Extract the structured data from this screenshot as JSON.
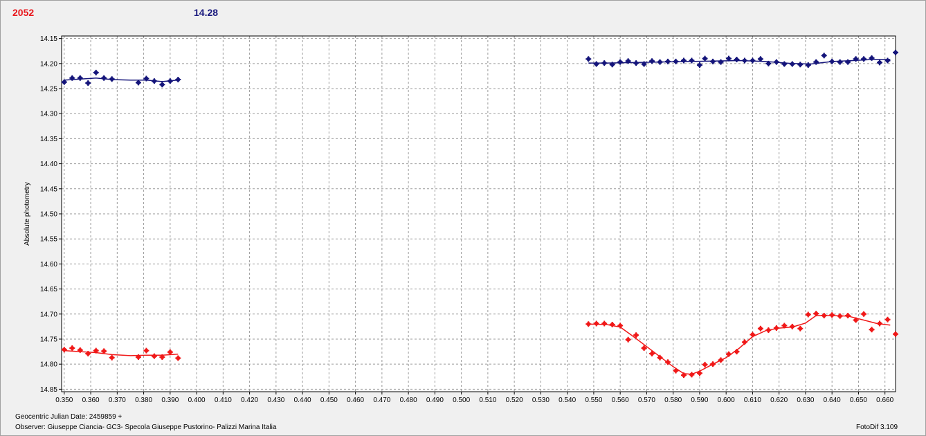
{
  "header": {
    "left_value": "2052",
    "right_value": "14.28"
  },
  "footer": {
    "julian_date": "Geocentric Julian Date: 2459859 +",
    "observer": "Observer: Giuseppe Ciancia- GC3- Specola Giuseppe Pustorino- Palizzi Marina Italia",
    "software": "FotoDif 3.109"
  },
  "colors": {
    "red_series": "#f01818",
    "blue_series": "#14147a",
    "grid": "#9a9a9a",
    "plot_bg": "#ffffff"
  },
  "chart_data": {
    "type": "scatter",
    "title": "",
    "xlabel": "",
    "ylabel": "Absolute photometry",
    "xlim": [
      0.349,
      0.664
    ],
    "ylim": [
      14.855,
      14.145
    ],
    "y_inverted": true,
    "grid": true,
    "x_ticks": [
      "0.350",
      "0.360",
      "0.370",
      "0.380",
      "0.390",
      "0.400",
      "0.410",
      "0.420",
      "0.430",
      "0.440",
      "0.450",
      "0.460",
      "0.470",
      "0.480",
      "0.490",
      "0.500",
      "0.510",
      "0.520",
      "0.530",
      "0.540",
      "0.550",
      "0.560",
      "0.570",
      "0.580",
      "0.590",
      "0.600",
      "0.610",
      "0.620",
      "0.630",
      "0.640",
      "0.650",
      "0.660"
    ],
    "y_ticks": [
      "14.15",
      "14.20",
      "14.25",
      "14.30",
      "14.35",
      "14.40",
      "14.45",
      "14.50",
      "14.55",
      "14.60",
      "14.65",
      "14.70",
      "14.75",
      "14.80",
      "14.85"
    ],
    "series": [
      {
        "color": "#14147a",
        "points": [
          [
            0.35,
            14.237
          ],
          [
            0.353,
            14.229
          ],
          [
            0.356,
            14.229
          ],
          [
            0.359,
            14.239
          ],
          [
            0.362,
            14.218
          ],
          [
            0.365,
            14.229
          ],
          [
            0.368,
            14.231
          ],
          [
            0.378,
            14.238
          ],
          [
            0.381,
            14.23
          ],
          [
            0.384,
            14.235
          ],
          [
            0.387,
            14.242
          ],
          [
            0.39,
            14.235
          ],
          [
            0.393,
            14.232
          ],
          [
            0.548,
            14.191
          ],
          [
            0.551,
            14.201
          ],
          [
            0.554,
            14.199
          ],
          [
            0.557,
            14.202
          ],
          [
            0.56,
            14.197
          ],
          [
            0.563,
            14.195
          ],
          [
            0.566,
            14.199
          ],
          [
            0.569,
            14.201
          ],
          [
            0.572,
            14.195
          ],
          [
            0.575,
            14.197
          ],
          [
            0.578,
            14.196
          ],
          [
            0.581,
            14.196
          ],
          [
            0.584,
            14.194
          ],
          [
            0.587,
            14.194
          ],
          [
            0.59,
            14.203
          ],
          [
            0.592,
            14.19
          ],
          [
            0.595,
            14.196
          ],
          [
            0.598,
            14.197
          ],
          [
            0.601,
            14.19
          ],
          [
            0.604,
            14.192
          ],
          [
            0.607,
            14.194
          ],
          [
            0.61,
            14.194
          ],
          [
            0.613,
            14.191
          ],
          [
            0.616,
            14.2
          ],
          [
            0.619,
            14.197
          ],
          [
            0.622,
            14.201
          ],
          [
            0.625,
            14.201
          ],
          [
            0.628,
            14.202
          ],
          [
            0.631,
            14.203
          ],
          [
            0.634,
            14.197
          ],
          [
            0.637,
            14.184
          ],
          [
            0.64,
            14.196
          ],
          [
            0.643,
            14.197
          ],
          [
            0.646,
            14.197
          ],
          [
            0.649,
            14.191
          ],
          [
            0.652,
            14.191
          ],
          [
            0.655,
            14.189
          ],
          [
            0.658,
            14.198
          ],
          [
            0.661,
            14.194
          ],
          [
            0.664,
            14.178
          ]
        ],
        "fit": [
          [
            0.35,
            14.233
          ],
          [
            0.356,
            14.231
          ],
          [
            0.362,
            14.229
          ],
          [
            0.368,
            14.232
          ],
          [
            0.375,
            14.233
          ],
          [
            0.381,
            14.233
          ],
          [
            0.387,
            14.236
          ],
          [
            0.393,
            14.233
          ],
          [
            0.548,
            14.199
          ],
          [
            0.555,
            14.199
          ],
          [
            0.565,
            14.198
          ],
          [
            0.575,
            14.197
          ],
          [
            0.585,
            14.196
          ],
          [
            0.595,
            14.195
          ],
          [
            0.605,
            14.194
          ],
          [
            0.615,
            14.196
          ],
          [
            0.625,
            14.2
          ],
          [
            0.632,
            14.201
          ],
          [
            0.64,
            14.196
          ],
          [
            0.648,
            14.194
          ],
          [
            0.655,
            14.192
          ],
          [
            0.662,
            14.192
          ]
        ]
      },
      {
        "color": "#f01818",
        "points": [
          [
            0.35,
            14.771
          ],
          [
            0.353,
            14.768
          ],
          [
            0.356,
            14.772
          ],
          [
            0.359,
            14.779
          ],
          [
            0.362,
            14.773
          ],
          [
            0.365,
            14.774
          ],
          [
            0.368,
            14.787
          ],
          [
            0.378,
            14.786
          ],
          [
            0.381,
            14.773
          ],
          [
            0.384,
            14.784
          ],
          [
            0.387,
            14.786
          ],
          [
            0.39,
            14.776
          ],
          [
            0.393,
            14.788
          ],
          [
            0.548,
            14.72
          ],
          [
            0.551,
            14.719
          ],
          [
            0.554,
            14.719
          ],
          [
            0.557,
            14.721
          ],
          [
            0.56,
            14.723
          ],
          [
            0.563,
            14.751
          ],
          [
            0.566,
            14.742
          ],
          [
            0.569,
            14.768
          ],
          [
            0.572,
            14.779
          ],
          [
            0.575,
            14.787
          ],
          [
            0.578,
            14.796
          ],
          [
            0.581,
            14.813
          ],
          [
            0.584,
            14.822
          ],
          [
            0.587,
            14.821
          ],
          [
            0.59,
            14.818
          ],
          [
            0.592,
            14.801
          ],
          [
            0.595,
            14.8
          ],
          [
            0.598,
            14.792
          ],
          [
            0.601,
            14.78
          ],
          [
            0.604,
            14.775
          ],
          [
            0.607,
            14.756
          ],
          [
            0.61,
            14.741
          ],
          [
            0.613,
            14.729
          ],
          [
            0.616,
            14.732
          ],
          [
            0.619,
            14.728
          ],
          [
            0.622,
            14.723
          ],
          [
            0.625,
            14.725
          ],
          [
            0.628,
            14.729
          ],
          [
            0.631,
            14.701
          ],
          [
            0.634,
            14.699
          ],
          [
            0.637,
            14.703
          ],
          [
            0.64,
            14.702
          ],
          [
            0.643,
            14.704
          ],
          [
            0.646,
            14.703
          ],
          [
            0.649,
            14.712
          ],
          [
            0.652,
            14.7
          ],
          [
            0.655,
            14.731
          ],
          [
            0.658,
            14.719
          ],
          [
            0.661,
            14.711
          ],
          [
            0.664,
            14.74
          ]
        ],
        "fit": [
          [
            0.35,
            14.773
          ],
          [
            0.356,
            14.775
          ],
          [
            0.362,
            14.777
          ],
          [
            0.368,
            14.781
          ],
          [
            0.375,
            14.783
          ],
          [
            0.381,
            14.782
          ],
          [
            0.387,
            14.782
          ],
          [
            0.393,
            14.78
          ],
          [
            0.548,
            14.72
          ],
          [
            0.555,
            14.721
          ],
          [
            0.56,
            14.726
          ],
          [
            0.565,
            14.745
          ],
          [
            0.57,
            14.765
          ],
          [
            0.575,
            14.785
          ],
          [
            0.58,
            14.805
          ],
          [
            0.584,
            14.819
          ],
          [
            0.587,
            14.82
          ],
          [
            0.59,
            14.814
          ],
          [
            0.595,
            14.8
          ],
          [
            0.6,
            14.787
          ],
          [
            0.605,
            14.768
          ],
          [
            0.61,
            14.745
          ],
          [
            0.615,
            14.733
          ],
          [
            0.62,
            14.728
          ],
          [
            0.625,
            14.726
          ],
          [
            0.63,
            14.718
          ],
          [
            0.634,
            14.703
          ],
          [
            0.64,
            14.703
          ],
          [
            0.646,
            14.704
          ],
          [
            0.652,
            14.712
          ],
          [
            0.657,
            14.719
          ],
          [
            0.662,
            14.722
          ]
        ]
      }
    ]
  }
}
